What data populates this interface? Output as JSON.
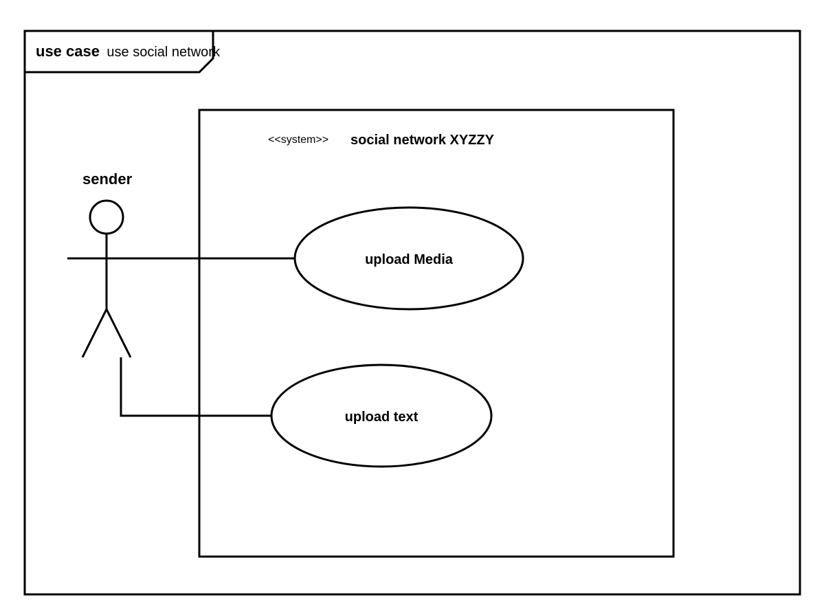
{
  "diagram": {
    "type": "uml-use-case",
    "frame": {
      "label_bold": "use case",
      "label_normal": "use social network"
    },
    "actor": {
      "name": "sender"
    },
    "system": {
      "stereotype": "<<system>>",
      "name": "social network XYZZY"
    },
    "use_cases": [
      {
        "id": "uc1",
        "label": "upload Media"
      },
      {
        "id": "uc2",
        "label": "upload text"
      }
    ],
    "associations": [
      {
        "from": "actor:sender",
        "to": "uc1"
      },
      {
        "from": "actor:sender",
        "to": "uc2"
      }
    ]
  }
}
